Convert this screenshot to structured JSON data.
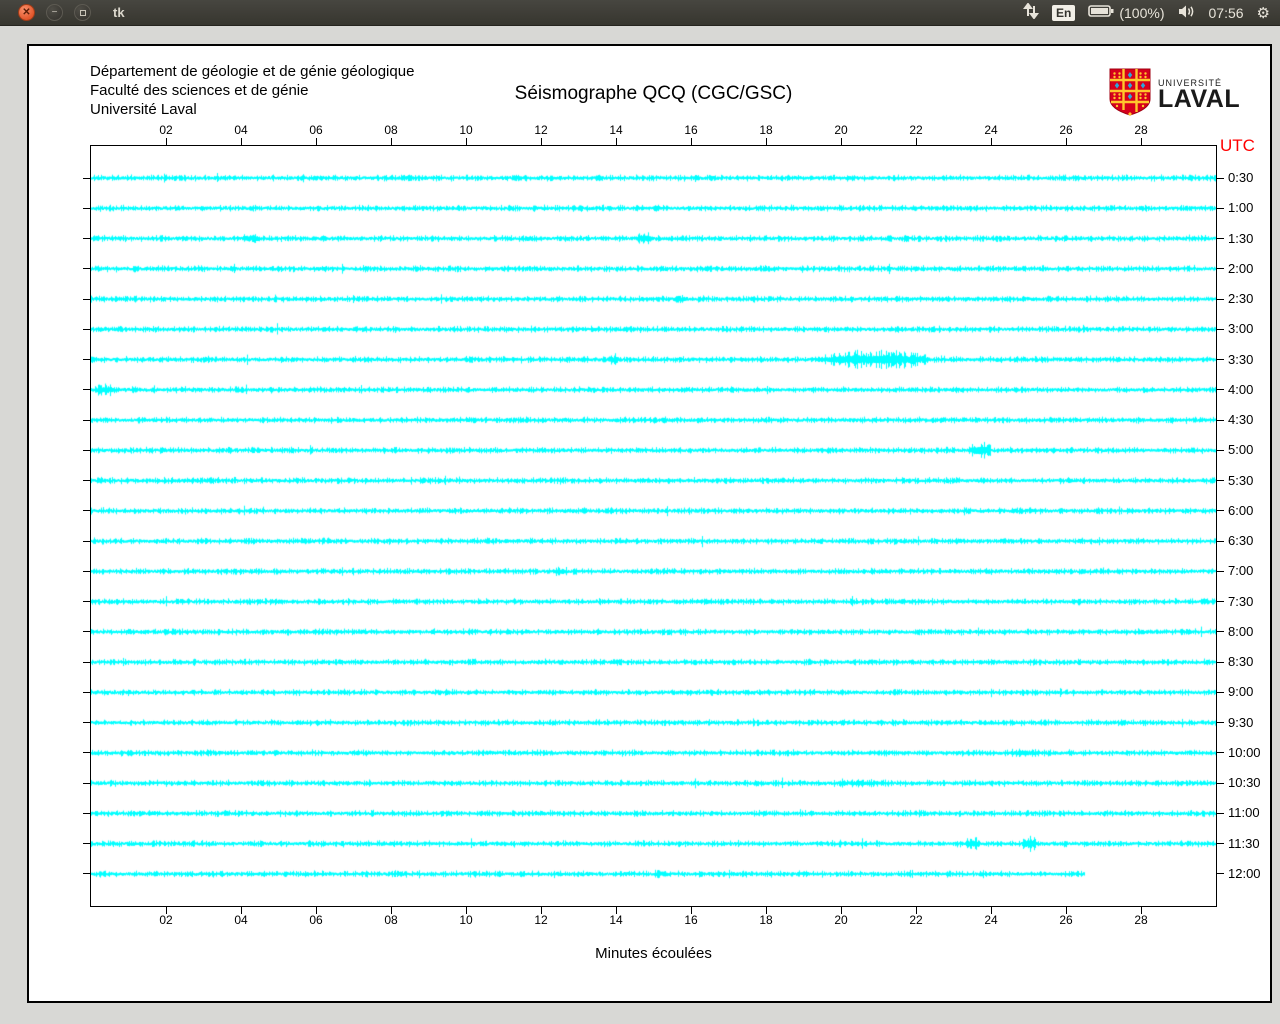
{
  "topbar": {
    "title": "tk",
    "keyboard_indicator": "En",
    "battery_pct": "(100%)",
    "clock": "07:56"
  },
  "window": {
    "dept_lines": "Département de géologie et de génie géologique\nFaculté des sciences et de génie\nUniversité Laval",
    "title": "Séismographe QCQ (CGC/GSC)",
    "logo_line1": "UNIVERSITÉ",
    "logo_line2": "LAVAL",
    "utc_label": "UTC",
    "xlabel": "Minutes écoulées"
  },
  "chart_data": {
    "type": "seismogram",
    "title": "Séismographe QCQ (CGC/GSC)",
    "xlabel": "Minutes écoulées",
    "trace_color": "#00ffff",
    "utc_color": "#ff0000",
    "x_range_min": [
      0,
      30
    ],
    "x_ticks": [
      "02",
      "04",
      "06",
      "08",
      "10",
      "12",
      "14",
      "16",
      "18",
      "20",
      "22",
      "24",
      "26",
      "28"
    ],
    "row_labels_utc": [
      "0:30",
      "1:00",
      "1:30",
      "2:00",
      "2:30",
      "3:00",
      "3:30",
      "4:00",
      "4:30",
      "5:00",
      "5:30",
      "6:00",
      "6:30",
      "7:00",
      "7:30",
      "8:00",
      "8:30",
      "9:00",
      "9:30",
      "10:00",
      "10:30",
      "11:00",
      "11:30",
      "12:00"
    ],
    "last_row_end_min": 26.5,
    "events": [
      {
        "row": 2,
        "start_min": 4.0,
        "end_min": 4.5,
        "amp": 2.0
      },
      {
        "row": 2,
        "start_min": 14.5,
        "end_min": 15.0,
        "amp": 2.2
      },
      {
        "row": 4,
        "start_min": 15.5,
        "end_min": 15.9,
        "amp": 1.8
      },
      {
        "row": 6,
        "start_min": 13.8,
        "end_min": 14.1,
        "amp": 2.0
      },
      {
        "row": 6,
        "start_min": 19.5,
        "end_min": 22.4,
        "amp": 3.2
      },
      {
        "row": 7,
        "start_min": 0.1,
        "end_min": 0.6,
        "amp": 2.2
      },
      {
        "row": 9,
        "start_min": 23.4,
        "end_min": 24.0,
        "amp": 3.0
      },
      {
        "row": 13,
        "start_min": 12.3,
        "end_min": 12.7,
        "amp": 1.7
      },
      {
        "row": 19,
        "start_min": 24.5,
        "end_min": 25.3,
        "amp": 1.8
      },
      {
        "row": 20,
        "start_min": 19.8,
        "end_min": 21.2,
        "amp": 1.4
      },
      {
        "row": 22,
        "start_min": 23.3,
        "end_min": 23.7,
        "amp": 2.4
      },
      {
        "row": 22,
        "start_min": 24.8,
        "end_min": 25.2,
        "amp": 2.8
      },
      {
        "row": 23,
        "start_min": 15.0,
        "end_min": 15.4,
        "amp": 1.6
      }
    ]
  }
}
